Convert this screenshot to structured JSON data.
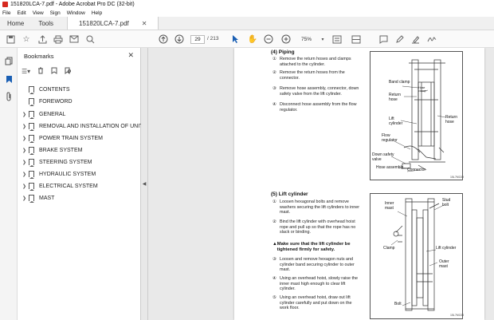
{
  "window": {
    "title": "151820LCA-7.pdf - Adobe Acrobat Pro DC (32-bit)"
  },
  "menu": [
    "File",
    "Edit",
    "View",
    "Sign",
    "Window",
    "Help"
  ],
  "tabs": {
    "home": "Home",
    "tools": "Tools",
    "document": "151820LCA-7.pdf"
  },
  "toolbar": {
    "page_current": "29",
    "page_total": "/ 213",
    "zoom": "75%"
  },
  "bookmarks": {
    "title": "Bookmarks",
    "items": [
      {
        "label": "CONTENTS",
        "expandable": false
      },
      {
        "label": "FOREWORD",
        "expandable": false
      },
      {
        "label": "GENERAL",
        "expandable": true
      },
      {
        "label": "REMOVAL AND INSTALLATION OF UNIT",
        "expandable": true
      },
      {
        "label": "POWER TRAIN SYSTEM",
        "expandable": true
      },
      {
        "label": "BRAKE SYSTEM",
        "expandable": true
      },
      {
        "label": "STEERING SYSTEM",
        "expandable": true
      },
      {
        "label": "HYDRAULIC SYSTEM",
        "expandable": true
      },
      {
        "label": "ELECTRICAL SYSTEM",
        "expandable": true
      },
      {
        "label": "MAST",
        "expandable": true
      }
    ]
  },
  "document": {
    "piping": {
      "heading": "(4) Piping",
      "steps": [
        {
          "n": "①",
          "text": "Remove the return hoses and clamps attached to the cylinder."
        },
        {
          "n": "②",
          "text": "Remove the return hoses from the connector."
        },
        {
          "n": "③",
          "text": "Remove hose assembly, connector, down safety valve from the lift cylinder."
        },
        {
          "n": "④",
          "text": "Disconnect hose assembly from the flow regulator."
        }
      ],
      "figure": {
        "labels": {
          "band_clamp": "Band clamp",
          "hose_clamp": "Hose clamp",
          "return_hose": "Return hose",
          "return_hose_right": "Return hose",
          "lift_cylinder": "Lift cylinder",
          "flow_regulator": "Flow regulator",
          "down_safety_valve": "Down safety valve",
          "hose_assembly": "Hose assembly",
          "connector": "Connector"
        },
        "code": "15L7MC09"
      }
    },
    "lift_cylinder": {
      "heading": "(5) Lift cylinder",
      "steps": [
        {
          "n": "①",
          "text": "Loosen hexagonal bolts and remove washers securing the lift cylinders to inner mast."
        },
        {
          "n": "②",
          "text": "Bind the lift cylinder with overhead hoist rope and pull up so that the rope has no slack or binding."
        }
      ],
      "warning": "Make sure that the lift cylinder be tightened firmly for safety.",
      "steps2": [
        {
          "n": "③",
          "text": "Loosen and remove hexagon nuts and cylinder band securing cylinder to outer mast."
        },
        {
          "n": "④",
          "text": "Using an overhead hoist, slowly raise the inner mast high enough to clear lift cylinder."
        },
        {
          "n": "⑤",
          "text": "Using an overhead hoist, draw out lift cylinder carefully and put down on the work floor."
        }
      ],
      "figure": {
        "labels": {
          "inner_mast": "Inner mast",
          "stud_bolt": "Stud bolt",
          "clamp": "Clamp",
          "lift_cylinder": "Lift cylinder",
          "outer_mast": "Outer mast",
          "bolt": "Bolt"
        },
        "code": "15L7MC08"
      }
    }
  }
}
